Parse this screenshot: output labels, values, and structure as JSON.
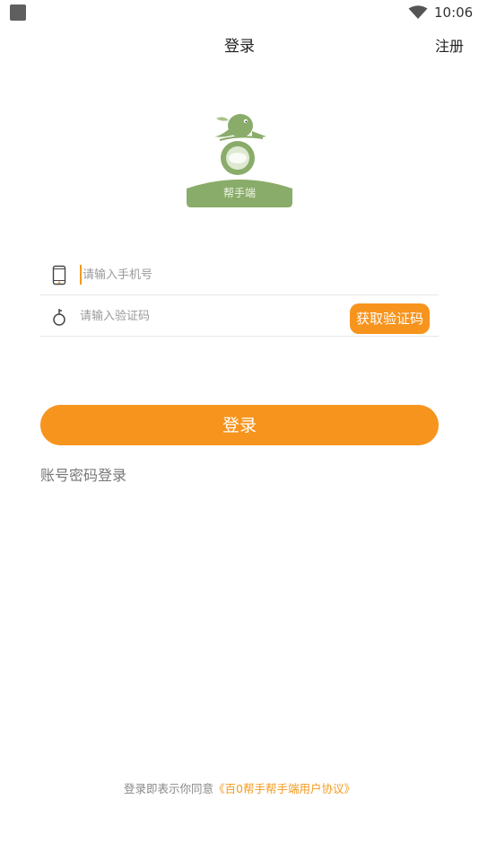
{
  "status_bar": {
    "time": "10:06"
  },
  "header": {
    "title": "登录",
    "register_label": "注册"
  },
  "logo": {
    "text": "帮手端"
  },
  "form": {
    "phone_placeholder": "请输入手机号",
    "phone_value": "",
    "code_placeholder": "请输入验证码",
    "code_value": "",
    "get_code_label": "获取验证码"
  },
  "login_button_label": "登录",
  "password_login_label": "账号密码登录",
  "agreement": {
    "prefix": "登录即表示你同意",
    "link": "《百0帮手帮手端用户协议》"
  },
  "colors": {
    "accent": "#f7941d",
    "logo_green": "#8aac6a"
  },
  "icons": [
    "wifi-icon",
    "phone-icon",
    "key-icon"
  ]
}
